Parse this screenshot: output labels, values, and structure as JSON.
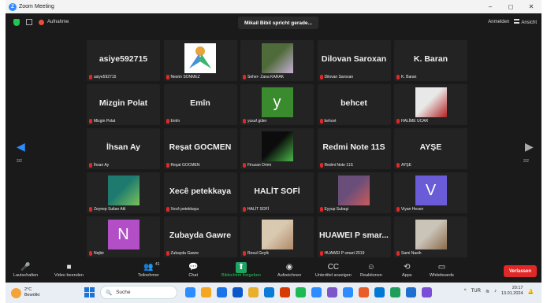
{
  "window": {
    "title": "Zoom Meeting",
    "controls": [
      "–",
      "◻",
      "✕"
    ]
  },
  "topbar": {
    "recording_label": "Aufnahme",
    "active_speaker": "Mikail Bibil spricht gerade...",
    "signin": "Anmelden",
    "view": "Ansicht"
  },
  "tiles": [
    {
      "big": "asiye592715",
      "label": "asiye592715"
    },
    {
      "label": "Nesrin SONMEZ",
      "pic": "logo",
      "colors": [
        "#4a90d9",
        "#e8a33a"
      ]
    },
    {
      "label": "Seher- Zana KARAK",
      "pic": "photo",
      "colors": [
        "#4f6b3a",
        "#c8b0d8"
      ]
    },
    {
      "big": "Dilovan Saroxan",
      "label": "Dilovan Saroxan"
    },
    {
      "big": "K. Baran",
      "label": "K. Baran"
    },
    {
      "big": "Mizgin Polat",
      "label": "Mizgin Polat"
    },
    {
      "big": "Emîn",
      "label": "Emîn"
    },
    {
      "label": "yusuf güler",
      "pic": "letter",
      "letter": "y",
      "colors": [
        "#3a8a2e"
      ]
    },
    {
      "big": "behcet",
      "label": "behcet"
    },
    {
      "label": "HALİME UCAR",
      "pic": "photo",
      "colors": [
        "#e8e8e8",
        "#b22222"
      ]
    },
    {
      "big": "İhsan Ay",
      "label": "İhsan Ay"
    },
    {
      "big": "Reşat GOCMEN",
      "label": "Reşat GOCMEN"
    },
    {
      "label": "Firuzan Orimi",
      "pic": "photo",
      "colors": [
        "#0c0c0c",
        "#4ab84a"
      ]
    },
    {
      "big": "Redmi Note 11S",
      "label": "Redmi Note 11S"
    },
    {
      "big": "AYŞE",
      "label": "AYŞE"
    },
    {
      "label": "Zeynep Sultan Atli",
      "pic": "photo",
      "colors": [
        "#1e7a6e",
        "#7ac35b"
      ]
    },
    {
      "big": "Xecê petekkaya",
      "label": "Xecê petekkaya"
    },
    {
      "big": "HALİT SOFİ",
      "label": "HALİT SOFİ"
    },
    {
      "label": "Eyyup Subaşi",
      "pic": "photo",
      "colors": [
        "#6a4e7a",
        "#cc5a5a"
      ]
    },
    {
      "label": "Viyan Hesen",
      "pic": "letter",
      "letter": "V",
      "colors": [
        "#6a5bd6"
      ]
    },
    {
      "label": "Nejbir",
      "pic": "letter",
      "letter": "N",
      "colors": [
        "#b24fc6"
      ]
    },
    {
      "big": "Zubayda Gawre",
      "label": "Zubayda Gawre"
    },
    {
      "label": "Resul Geyik",
      "pic": "photo",
      "colors": [
        "#d9c9b0",
        "#b08a6a"
      ]
    },
    {
      "big": "HUAWEI P smar...",
      "label": "HUAWEI P smart 2019"
    },
    {
      "label": "Sami Nasih",
      "pic": "photo",
      "colors": [
        "#c9c3b8",
        "#8a6a4a"
      ]
    }
  ],
  "pages": {
    "left": "2/2",
    "right": "2/2"
  },
  "toolbar": {
    "items": [
      {
        "icon": "🎤",
        "label": "Lautschalten"
      },
      {
        "icon": "■",
        "label": "Video beenden"
      },
      {
        "icon": "👥",
        "label": "Teilnehmer",
        "count": "41"
      },
      {
        "icon": "💬",
        "label": "Chat"
      },
      {
        "icon": "⬆",
        "label": "Bildschirm freigeben"
      },
      {
        "icon": "◉",
        "label": "Aufzeichnen"
      },
      {
        "icon": "CC",
        "label": "Untertitel anzeigen"
      },
      {
        "icon": "☺",
        "label": "Reaktionen"
      },
      {
        "icon": "⟲",
        "label": "Apps"
      },
      {
        "icon": "▭",
        "label": "Whiteboards"
      }
    ],
    "leave": "Verlassen"
  },
  "taskbar": {
    "temp": "2°C",
    "weather": "Bewölkt",
    "search": "Suche",
    "lang": "TUR",
    "time": "20:17",
    "date": "13.01.2024",
    "app_colors": [
      "#2d8cff",
      "#f5a623",
      "#1a73e8",
      "#0a58ca",
      "#e9b02c",
      "#0b7bd6",
      "#d83b01",
      "#1db954",
      "#2d8cff",
      "#7b57c7",
      "#2d8cff",
      "#e85d2a",
      "#0078d4",
      "#1e9e5a",
      "#1f6fd1",
      "#7a4fd6"
    ],
    "highlight_color": "#1ea362"
  }
}
